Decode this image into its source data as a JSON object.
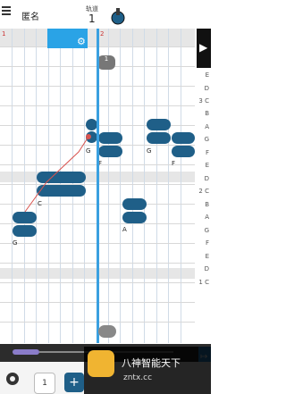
{
  "header": {
    "user": "匿名",
    "track_label": "轨道",
    "track_number": "1"
  },
  "grid": {
    "bar_numbers": [
      "1",
      "2"
    ],
    "measure_badge": "1",
    "right_labels": [
      {
        "label": "E"
      },
      {
        "label": "D"
      },
      {
        "label": "3 C"
      },
      {
        "label": "B"
      },
      {
        "label": "A"
      },
      {
        "label": "G"
      },
      {
        "label": "F"
      },
      {
        "label": "E"
      },
      {
        "label": "D"
      },
      {
        "label": "2 C"
      },
      {
        "label": "B"
      },
      {
        "label": "A"
      },
      {
        "label": "G"
      },
      {
        "label": "F"
      },
      {
        "label": "E"
      },
      {
        "label": "D"
      },
      {
        "label": "1 C"
      }
    ],
    "note_labels": [
      "G",
      "C",
      "G",
      "F",
      "A",
      "G",
      "F"
    ]
  },
  "footer": {
    "page": "1",
    "add": "+"
  },
  "watermark": {
    "line1": "八神智能天下",
    "line2": "zntx.cc"
  },
  "colors": {
    "note": "#1f5f88",
    "accent": "#2aa3e6"
  }
}
